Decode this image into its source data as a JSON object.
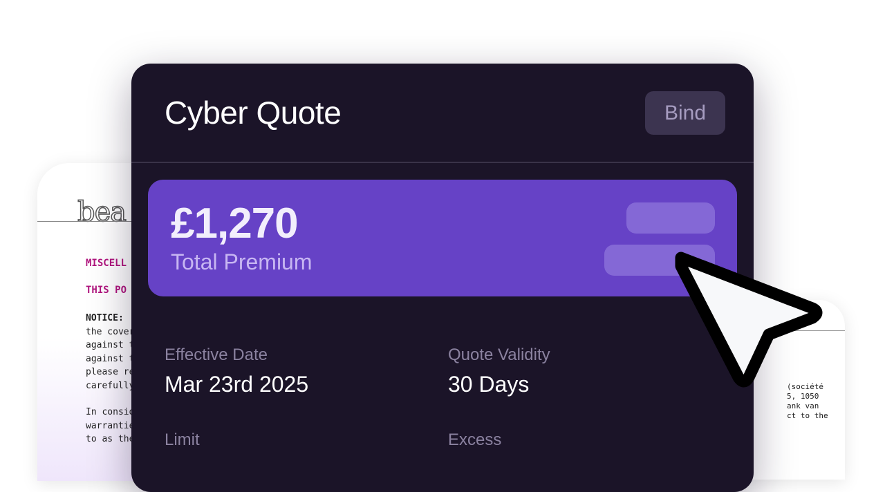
{
  "background_docs": {
    "left": {
      "logo_text": "bea",
      "heading_1": "MISCELL",
      "heading_2": "THIS PO",
      "paragraph_1": {
        "notice_label": "NOTICE:",
        "lines": [
          "the cover",
          "against th",
          "against th",
          "please re",
          "carefully"
        ]
      },
      "paragraph_2": {
        "lines": [
          "In consid",
          "warrantie",
          "to as the"
        ]
      }
    },
    "right": {
      "lines": [
        "(société",
        "5, 1050",
        "ank van",
        "ct to the"
      ]
    }
  },
  "quote": {
    "title": "Cyber Quote",
    "bind_label": "Bind",
    "premium_amount": "£1,270",
    "premium_label": "Total Premium",
    "fields": {
      "effective_date_label": "Effective Date",
      "effective_date_value": "Mar 23rd 2025",
      "quote_validity_label": "Quote Validity",
      "quote_validity_value": "30 Days",
      "limit_label": "Limit",
      "excess_label": "Excess"
    }
  },
  "colors": {
    "card_background": "#1b1428",
    "premium_panel": "#6642c6",
    "accent_text": "#c7b6f2",
    "document_heading": "#b0157e"
  },
  "cursor_icon": "arrow-pointer-icon"
}
